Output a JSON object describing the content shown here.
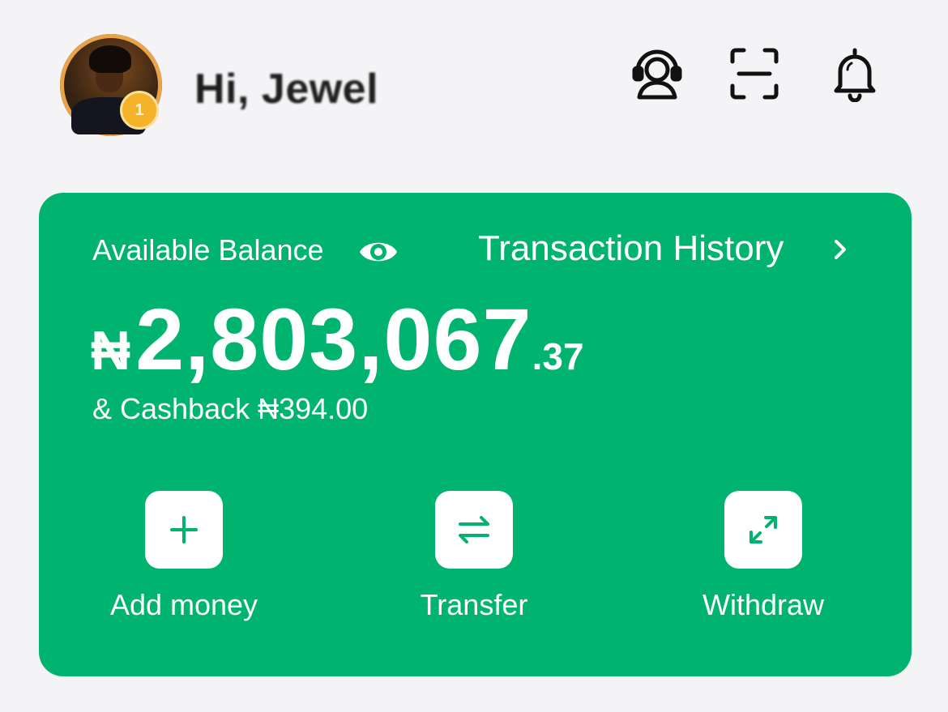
{
  "header": {
    "greeting": "Hi, Jewel",
    "badge_text": "1",
    "icons": [
      "support-agent-icon",
      "scan-icon",
      "bell-icon"
    ]
  },
  "balance_card": {
    "label": "Available Balance",
    "history_link": "Transaction History",
    "currency_symbol": "₦",
    "amount_main": "2,803,067",
    "amount_decimal": ".37",
    "cashback": "& Cashback ₦394.00"
  },
  "actions": [
    {
      "label": "Add money",
      "icon": "plus-icon"
    },
    {
      "label": "Transfer",
      "icon": "transfer-icon"
    },
    {
      "label": "Withdraw",
      "icon": "withdraw-icon"
    }
  ],
  "colors": {
    "accent": "#00b46f",
    "background": "#f4f4f7",
    "text_dark": "#1f1f1f",
    "badge": "#f5b22b"
  }
}
